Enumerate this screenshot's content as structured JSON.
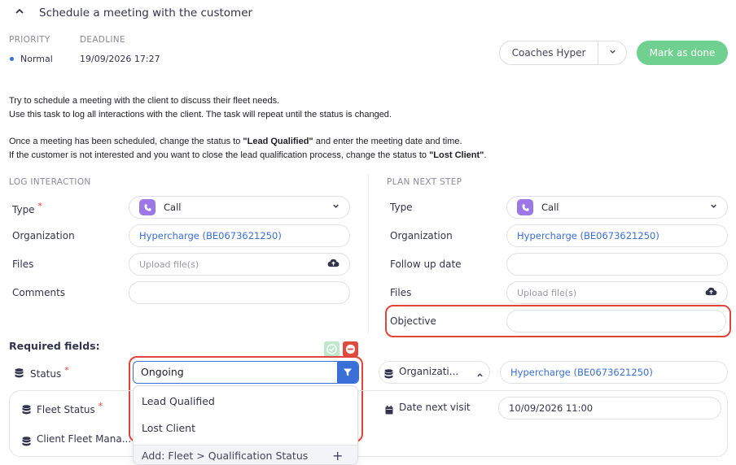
{
  "header": {
    "title": "Schedule a meeting with the customer"
  },
  "meta": {
    "priority_label": "PRIORITY",
    "priority_value": "Normal",
    "deadline_label": "DEADLINE",
    "deadline_value": "19/09/2026 17:27"
  },
  "actions": {
    "owner": "Coaches Hyper",
    "mark_done": "Mark as done"
  },
  "description": {
    "line1": "Try to schedule a meeting with the client to discuss their fleet needs.",
    "line2": "Use this task to log all interactions with the client. The task will repeat until the status is changed.",
    "line3_pre": "Once a meeting has been scheduled, change the status to ",
    "line3_bold": "\"Lead Qualified\"",
    "line3_post": " and enter the meeting date and time.",
    "line4_pre": "If the customer is not interested and you want to close the lead qualification process, change the status to ",
    "line4_bold": "\"Lost Client\"",
    "line4_post": "."
  },
  "log": {
    "section": "LOG INTERACTION",
    "type_label": "Type",
    "type_value": "Call",
    "org_label": "Organization",
    "org_value": "Hypercharge (BE0673621250)",
    "files_label": "Files",
    "files_placeholder": "Upload file(s)",
    "comments_label": "Comments"
  },
  "plan": {
    "section": "PLAN NEXT STEP",
    "type_label": "Type",
    "type_value": "Call",
    "org_label": "Organization",
    "org_value": "Hypercharge (BE0673621250)",
    "followup_label": "Follow up date",
    "files_label": "Files",
    "files_placeholder": "Upload file(s)",
    "objective_label": "Objective"
  },
  "required": {
    "title": "Required fields:",
    "status_label": "Status",
    "status_value": "Ongoing",
    "org_label": "Organizati...",
    "org_value": "Hypercharge (BE0673621250)",
    "fleet_status_label": "Fleet Status",
    "fleet_manager_label": "Client Fleet Mana...",
    "date_next_visit_label": "Date next visit",
    "date_next_visit_value": "10/09/2026 11:00"
  },
  "status_dropdown": {
    "options": [
      "Lead Qualified",
      "Lost Client"
    ],
    "add_label": "Add: Fleet > Qualification Status"
  },
  "colors": {
    "accent": "#3a6fd8",
    "done": "#6fd08f",
    "highlight": "#e0443a",
    "call_icon": "#9b78e6"
  }
}
